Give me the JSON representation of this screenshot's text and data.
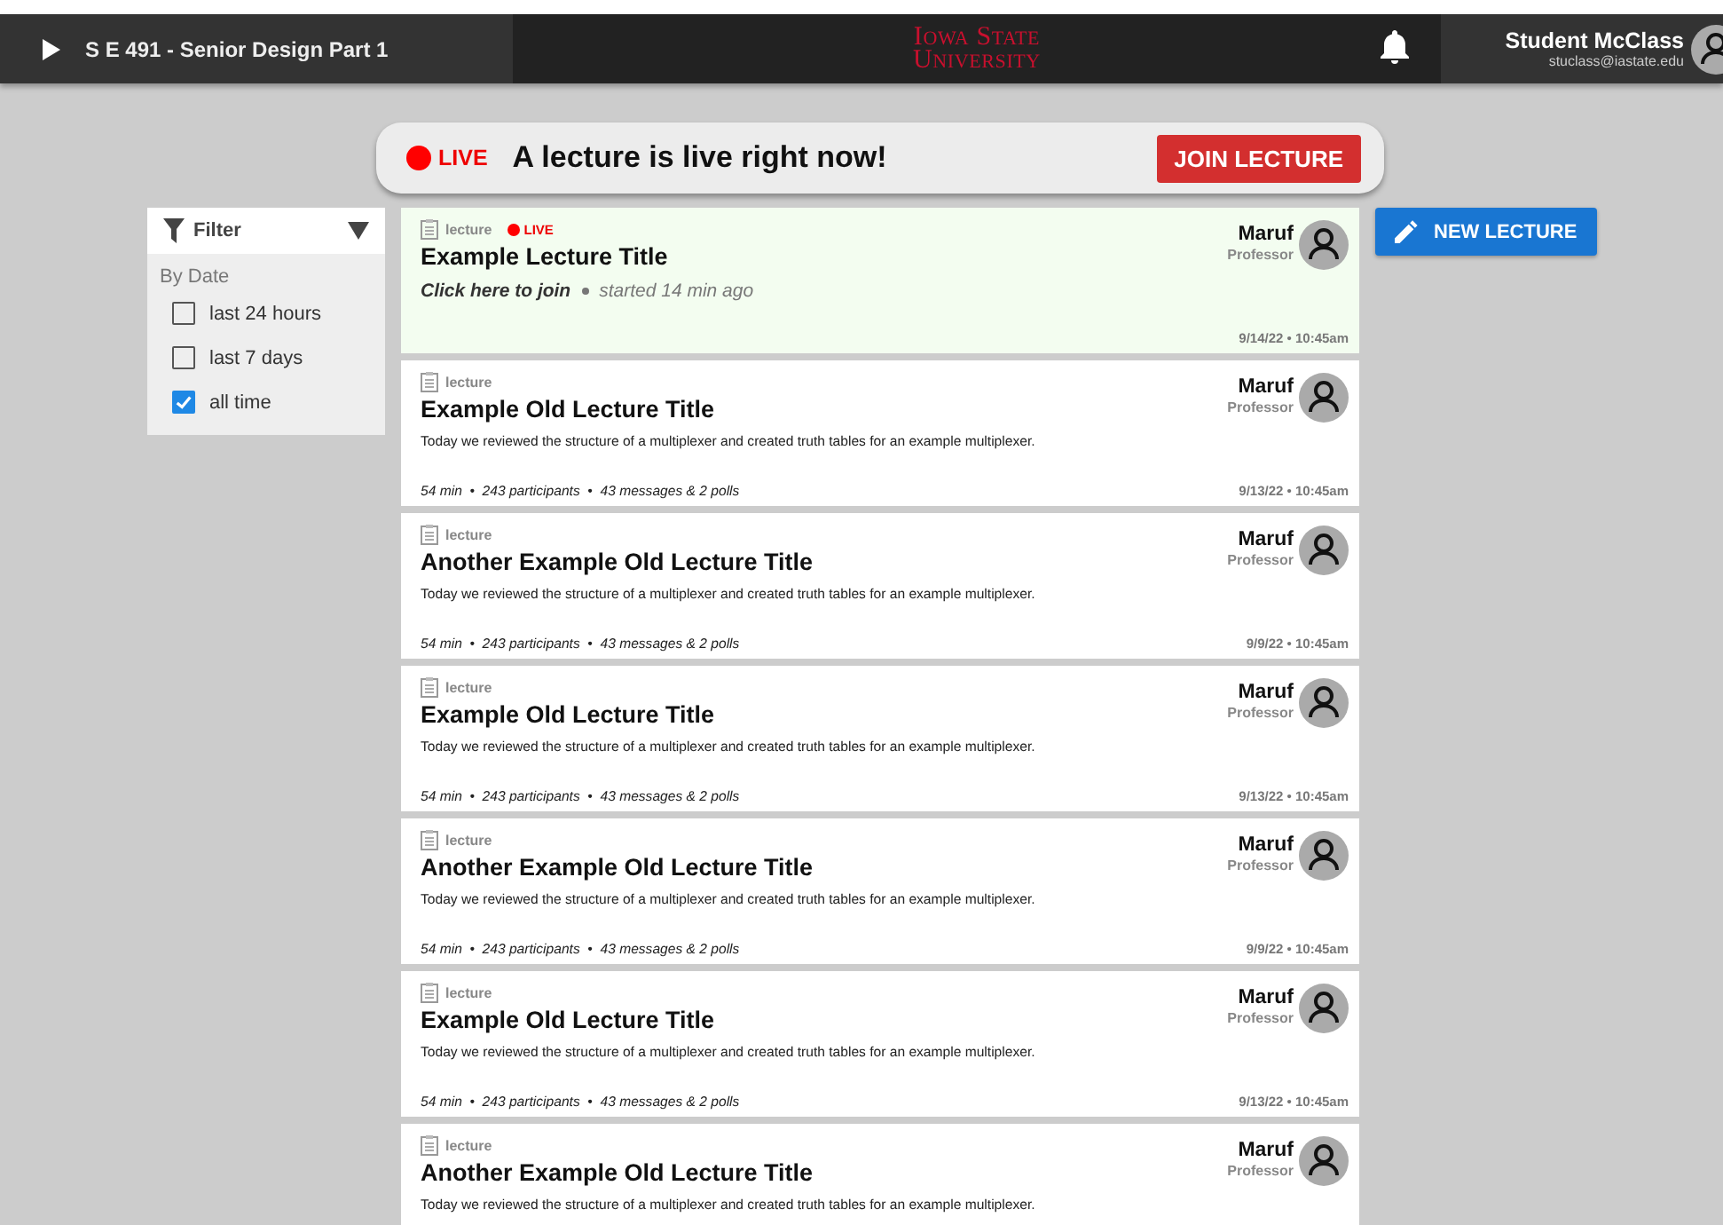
{
  "top_bar": {
    "course": "S E 491 - Senior Design Part 1",
    "logo": [
      "Iowa State",
      "University"
    ],
    "user": {
      "name": "Student McClass",
      "email": "stuclass@iastate.edu"
    }
  },
  "live_banner": {
    "badge": "LIVE",
    "message": "A lecture is live right now!",
    "button": "JOIN LECTURE"
  },
  "filter": {
    "title": "Filter",
    "section": "By Date",
    "options": [
      {
        "label": "last 24 hours",
        "checked": false
      },
      {
        "label": "last 7 days",
        "checked": false
      },
      {
        "label": "all time",
        "checked": true
      }
    ]
  },
  "new_lecture_button": "NEW LECTURE",
  "lectures": [
    {
      "kind": "live",
      "tag": "lecture",
      "live_badge": "LIVE",
      "title": "Example Lecture Title",
      "join": "Click here to join",
      "started": "started 14 min ago",
      "author": "Maruf",
      "role": "Professor",
      "date": "9/14/22 • 10:45am"
    },
    {
      "kind": "past",
      "tag": "lecture",
      "title": "Example Old Lecture Title",
      "description": "Today we reviewed the structure of a multiplexer and created truth tables for an example multiplexer.",
      "meta": "54 min  •  243 participants  •  43 messages & 2 polls",
      "author": "Maruf",
      "role": "Professor",
      "date": "9/13/22 • 10:45am"
    },
    {
      "kind": "past",
      "tag": "lecture",
      "title": "Another Example Old Lecture Title",
      "description": "Today we reviewed the structure of a multiplexer and created truth tables for an example multiplexer.",
      "meta": "54 min  •  243 participants  •  43 messages & 2 polls",
      "author": "Maruf",
      "role": "Professor",
      "date": "9/9/22 • 10:45am"
    },
    {
      "kind": "past",
      "tag": "lecture",
      "title": "Example Old Lecture Title",
      "description": "Today we reviewed the structure of a multiplexer and created truth tables for an example multiplexer.",
      "meta": "54 min  •  243 participants  •  43 messages & 2 polls",
      "author": "Maruf",
      "role": "Professor",
      "date": "9/13/22 • 10:45am"
    },
    {
      "kind": "past",
      "tag": "lecture",
      "title": "Another Example Old Lecture Title",
      "description": "Today we reviewed the structure of a multiplexer and created truth tables for an example multiplexer.",
      "meta": "54 min  •  243 participants  •  43 messages & 2 polls",
      "author": "Maruf",
      "role": "Professor",
      "date": "9/9/22 • 10:45am"
    },
    {
      "kind": "past",
      "tag": "lecture",
      "title": "Example Old Lecture Title",
      "description": "Today we reviewed the structure of a multiplexer and created truth tables for an example multiplexer.",
      "meta": "54 min  •  243 participants  •  43 messages & 2 polls",
      "author": "Maruf",
      "role": "Professor",
      "date": "9/13/22 • 10:45am"
    },
    {
      "kind": "past",
      "tag": "lecture",
      "title": "Another Example Old Lecture Title",
      "description": "Today we reviewed the structure of a multiplexer and created truth tables for an example multiplexer.",
      "author": "Maruf",
      "role": "Professor"
    }
  ]
}
